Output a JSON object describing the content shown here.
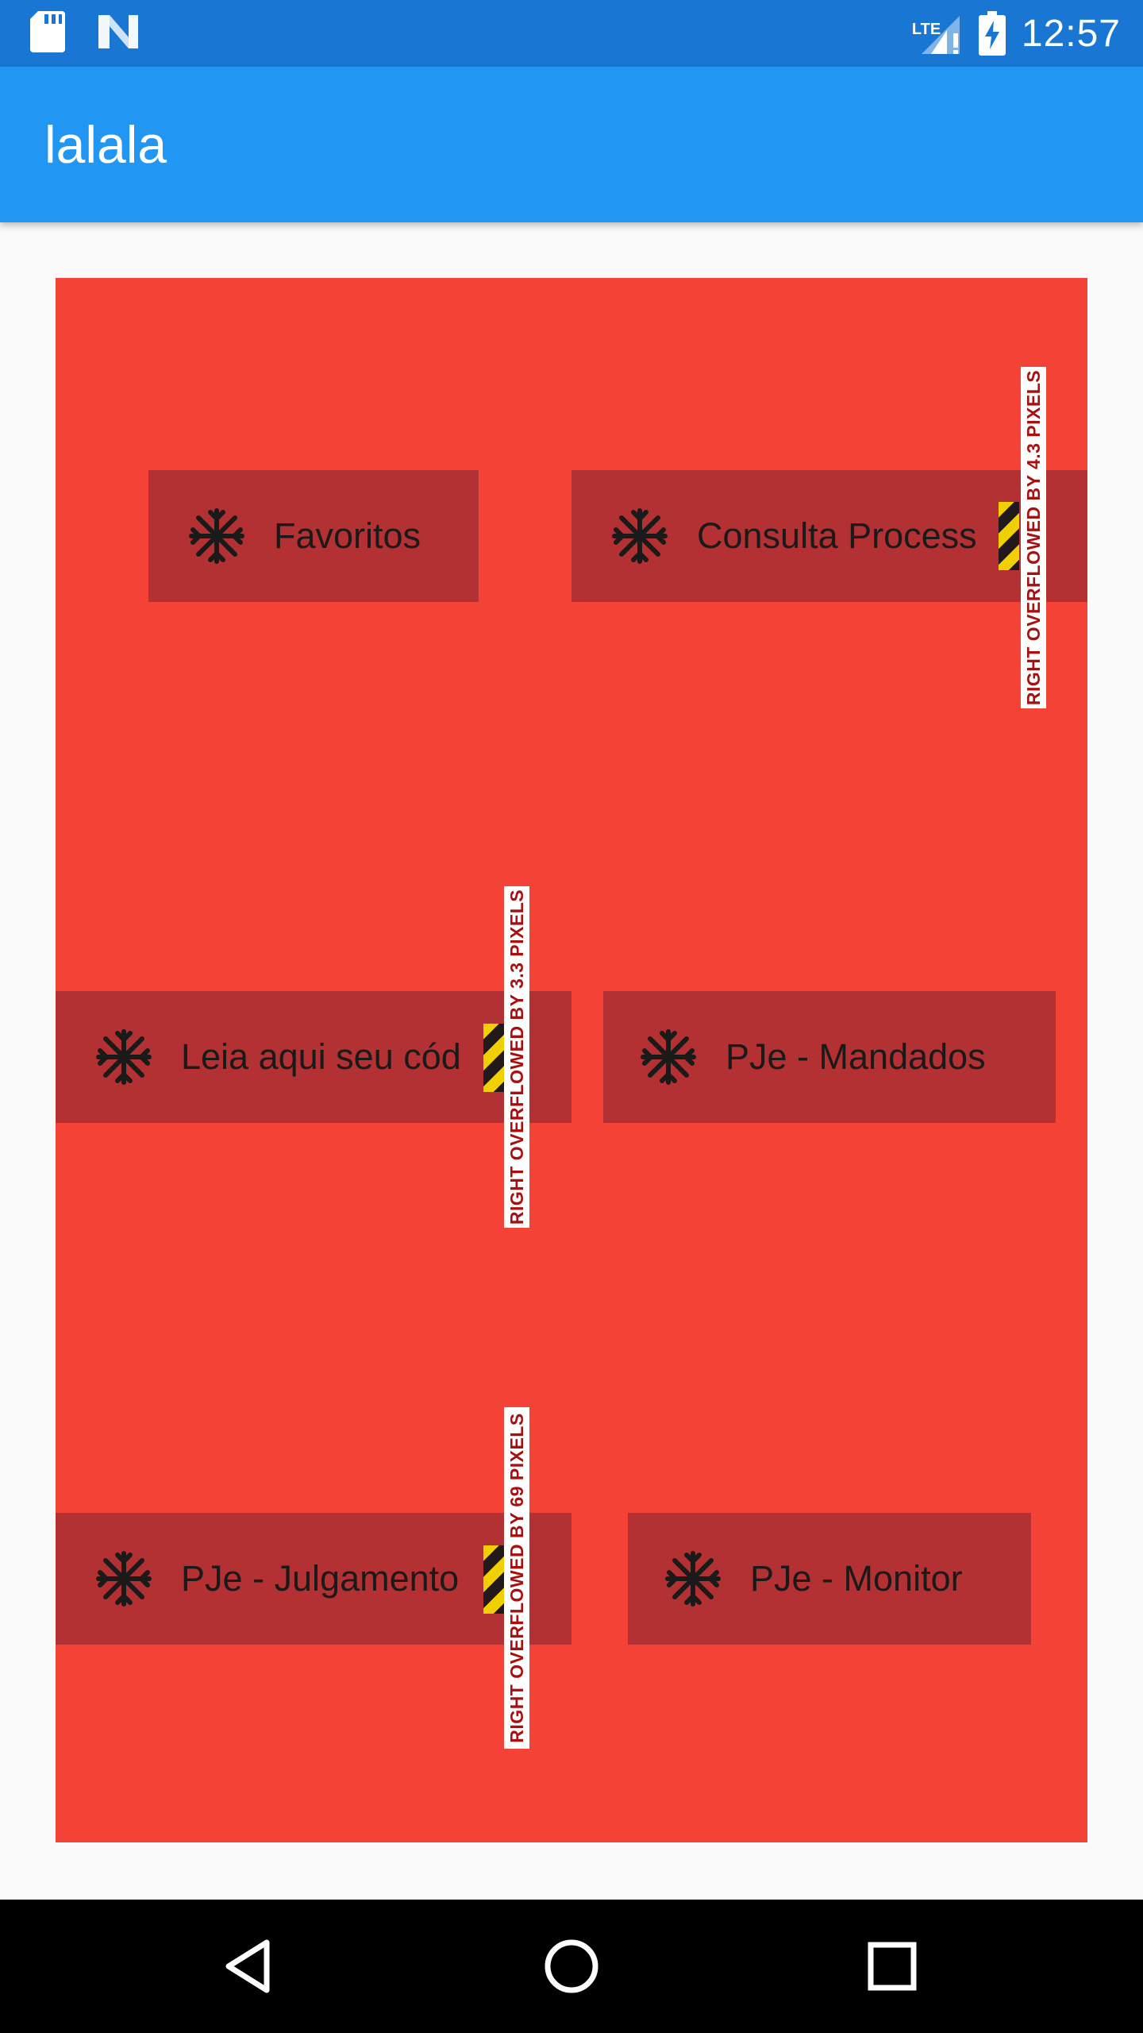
{
  "status_bar": {
    "time": "12:57",
    "network": "LTE",
    "icons": [
      "sd-card-icon",
      "n-logo-icon",
      "signal-alert-icon",
      "battery-charging-icon"
    ]
  },
  "app_bar": {
    "title": "lalala"
  },
  "colors": {
    "status_bar": "#1976d2",
    "app_bar": "#2196f3",
    "panel": "#f44336",
    "tile": "#b33033",
    "nav_bar": "#000000"
  },
  "tiles": [
    {
      "label": "Favoritos",
      "icon": "snowflake-icon"
    },
    {
      "label": "Consulta Process",
      "icon": "snowflake-icon"
    },
    {
      "label": "Leia aqui seu cód",
      "icon": "snowflake-icon"
    },
    {
      "label": "PJe - Mandados",
      "icon": "snowflake-icon"
    },
    {
      "label": "PJe - Julgamento",
      "icon": "snowflake-icon"
    },
    {
      "label": "PJe - Monitor",
      "icon": "snowflake-icon"
    }
  ],
  "overflow_warnings": [
    {
      "text": "RIGHT OVERFLOWED BY 4.3 PIXELS"
    },
    {
      "text": "RIGHT OVERFLOWED BY 3.3 PIXELS"
    },
    {
      "text": "RIGHT OVERFLOWED BY 69 PIXELS"
    }
  ],
  "nav_bar": {
    "buttons": [
      "back-icon",
      "home-icon",
      "recents-icon"
    ]
  }
}
